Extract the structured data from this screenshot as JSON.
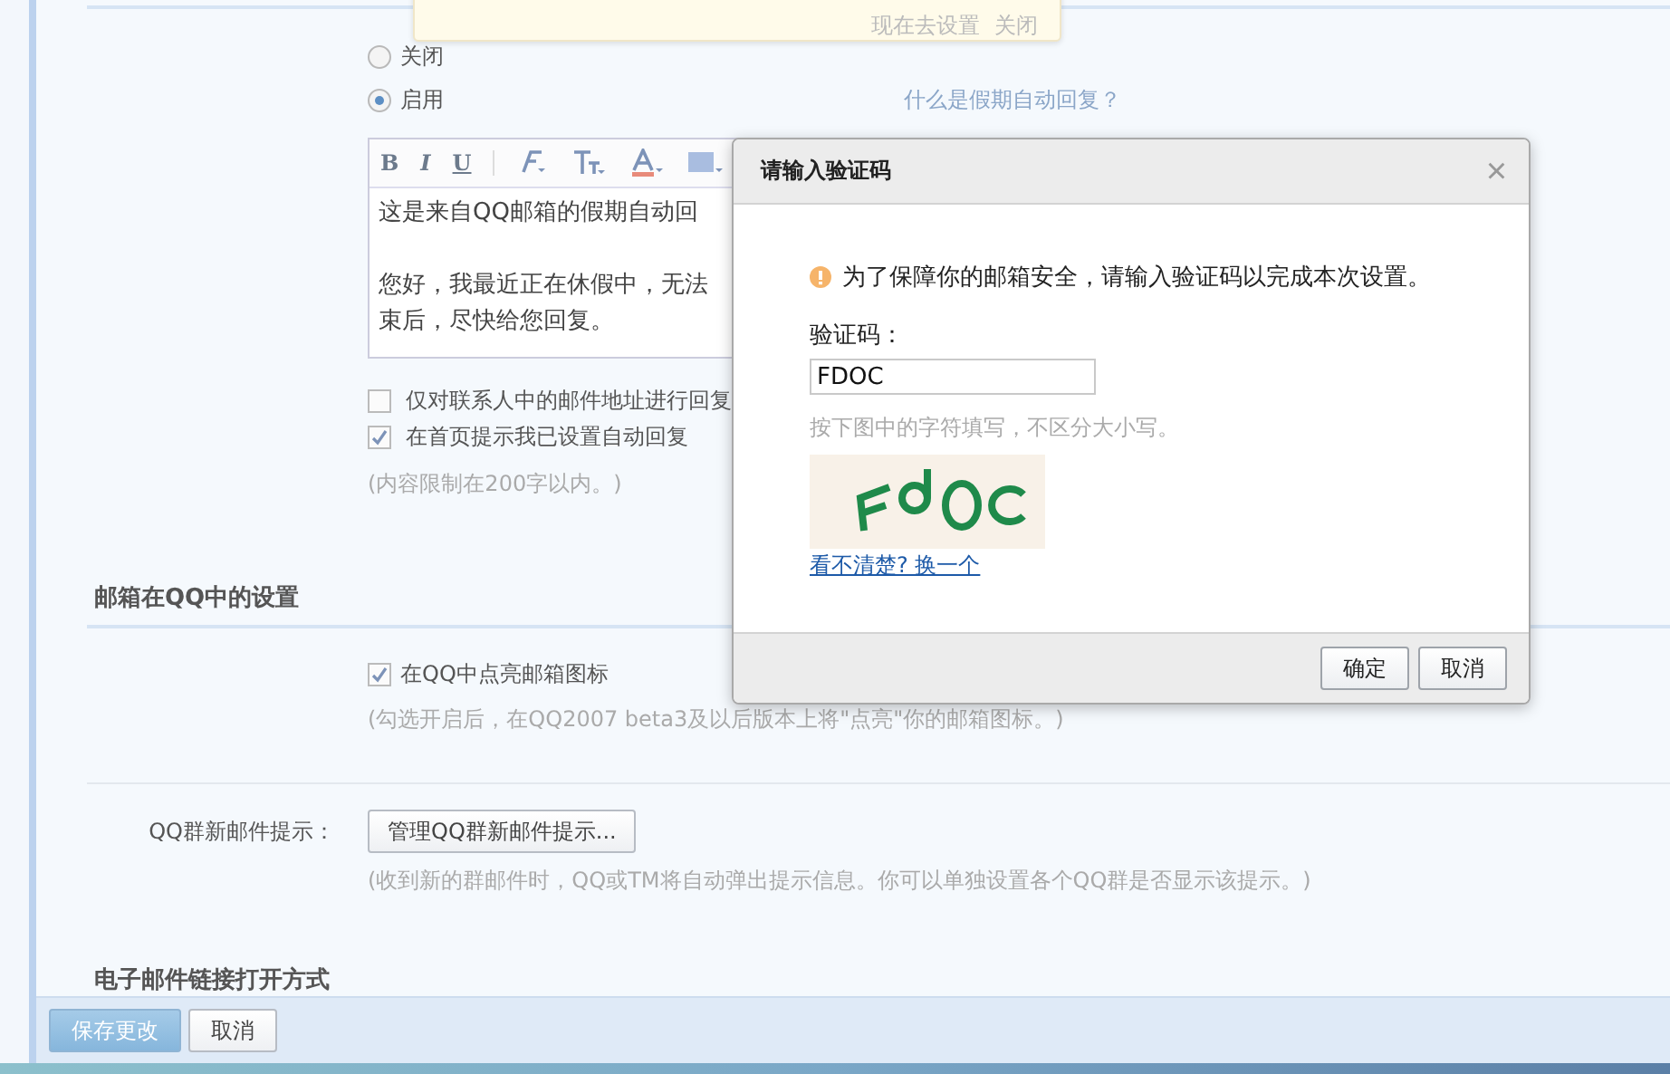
{
  "notice": {
    "links": [
      "现在去设置",
      "关闭"
    ]
  },
  "vacation_reply": {
    "options": [
      {
        "label": "关闭",
        "selected": false
      },
      {
        "label": "启用",
        "selected": true
      }
    ],
    "help_link": "什么是假期自动回复？",
    "toolbar": [
      "B",
      "I",
      "U"
    ],
    "editor_paragraphs": [
      [
        "这是来自QQ邮箱的假期自动回"
      ],
      [
        "您好，我最近正在休假中，无法",
        "束后，尽快给您回复。"
      ]
    ],
    "checkboxes": [
      {
        "label": "仅对联系人中的邮件地址进行回复",
        "checked": false
      },
      {
        "label": "在首页提示我已设置自动回复",
        "checked": true
      }
    ],
    "hint": "(内容限制在200字以内。)"
  },
  "qq_settings": {
    "heading": "邮箱在QQ中的设置",
    "checkbox": {
      "label": "在QQ中点亮邮箱图标",
      "checked": true
    },
    "hint": "(勾选开启后，在QQ2007 beta3及以后版本上将\"点亮\"你的邮箱图标。)",
    "group_mail_label": "QQ群新邮件提示：",
    "group_mail_button": "管理QQ群新邮件提示...",
    "group_mail_hint": "(收到新的群邮件时，QQ或TM将自动弹出提示信息。你可以单独设置各个QQ群是否显示该提示。)"
  },
  "link_open_heading": "电子邮件链接打开方式",
  "footer_buttons": [
    {
      "label": "保存更改",
      "kind": "primary"
    },
    {
      "label": "取消",
      "kind": "secondary"
    }
  ],
  "dialog": {
    "title": "请输入验证码",
    "close": "×",
    "warning": "为了保障你的邮箱安全，请输入验证码以完成本次设置。",
    "field_label": "验证码：",
    "field_value": "FDOC",
    "field_hint": "按下图中的字符填写，不区分大小写。",
    "refresh_link": "看不清楚? 换一个",
    "buttons": [
      "确定",
      "取消"
    ]
  }
}
